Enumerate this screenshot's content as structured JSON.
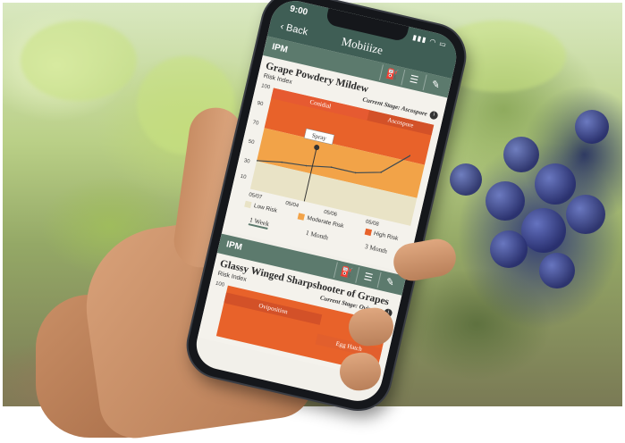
{
  "app": {
    "time": "9:00",
    "back_label": "Back",
    "title": "Mobiiize"
  },
  "cards": [
    {
      "section": "IPM",
      "title": "Grape Powdery Mildew",
      "subtitle": "Risk Index",
      "stage": "Current Stage: Ascospore",
      "phases": [
        "Conidial",
        "Ascospore"
      ],
      "annotation": "Spray",
      "tools": [
        "spray-bottle-icon",
        "list-icon",
        "wrench-icon"
      ]
    },
    {
      "section": "IPM",
      "title": "Glassy Winged Sharpshooter of Grapes",
      "subtitle": "Risk Index",
      "stage": "Current Stage: Ovipositi",
      "phases": [
        "Oviposition",
        "Egg Hatch"
      ],
      "tools": [
        "spray-bottle-icon",
        "list-icon",
        "wrench-icon"
      ]
    }
  ],
  "chart_data": {
    "type": "line",
    "y_ticks": [
      "100",
      "90",
      "70",
      "50",
      "30",
      "10"
    ],
    "x_ticks": [
      "05/07",
      "05/04",
      "05/06",
      "05/08"
    ],
    "legend": [
      "Low Risk",
      "Moderate Risk",
      "High Risk"
    ],
    "ylim": [
      0,
      100
    ],
    "series": [
      {
        "x": [
          0,
          1,
          2,
          3,
          4,
          5,
          6
        ],
        "values": [
          28,
          32,
          34,
          38,
          38,
          44,
          66
        ]
      }
    ]
  },
  "ranges": [
    "1 Week",
    "1 Month",
    "3 Month"
  ],
  "colors": {
    "header": "#3f5e55",
    "card_header": "#5c7a6d",
    "high_risk": "#e8622a",
    "moderate_risk": "#f2a348",
    "low_risk": "#e9e3c6"
  }
}
